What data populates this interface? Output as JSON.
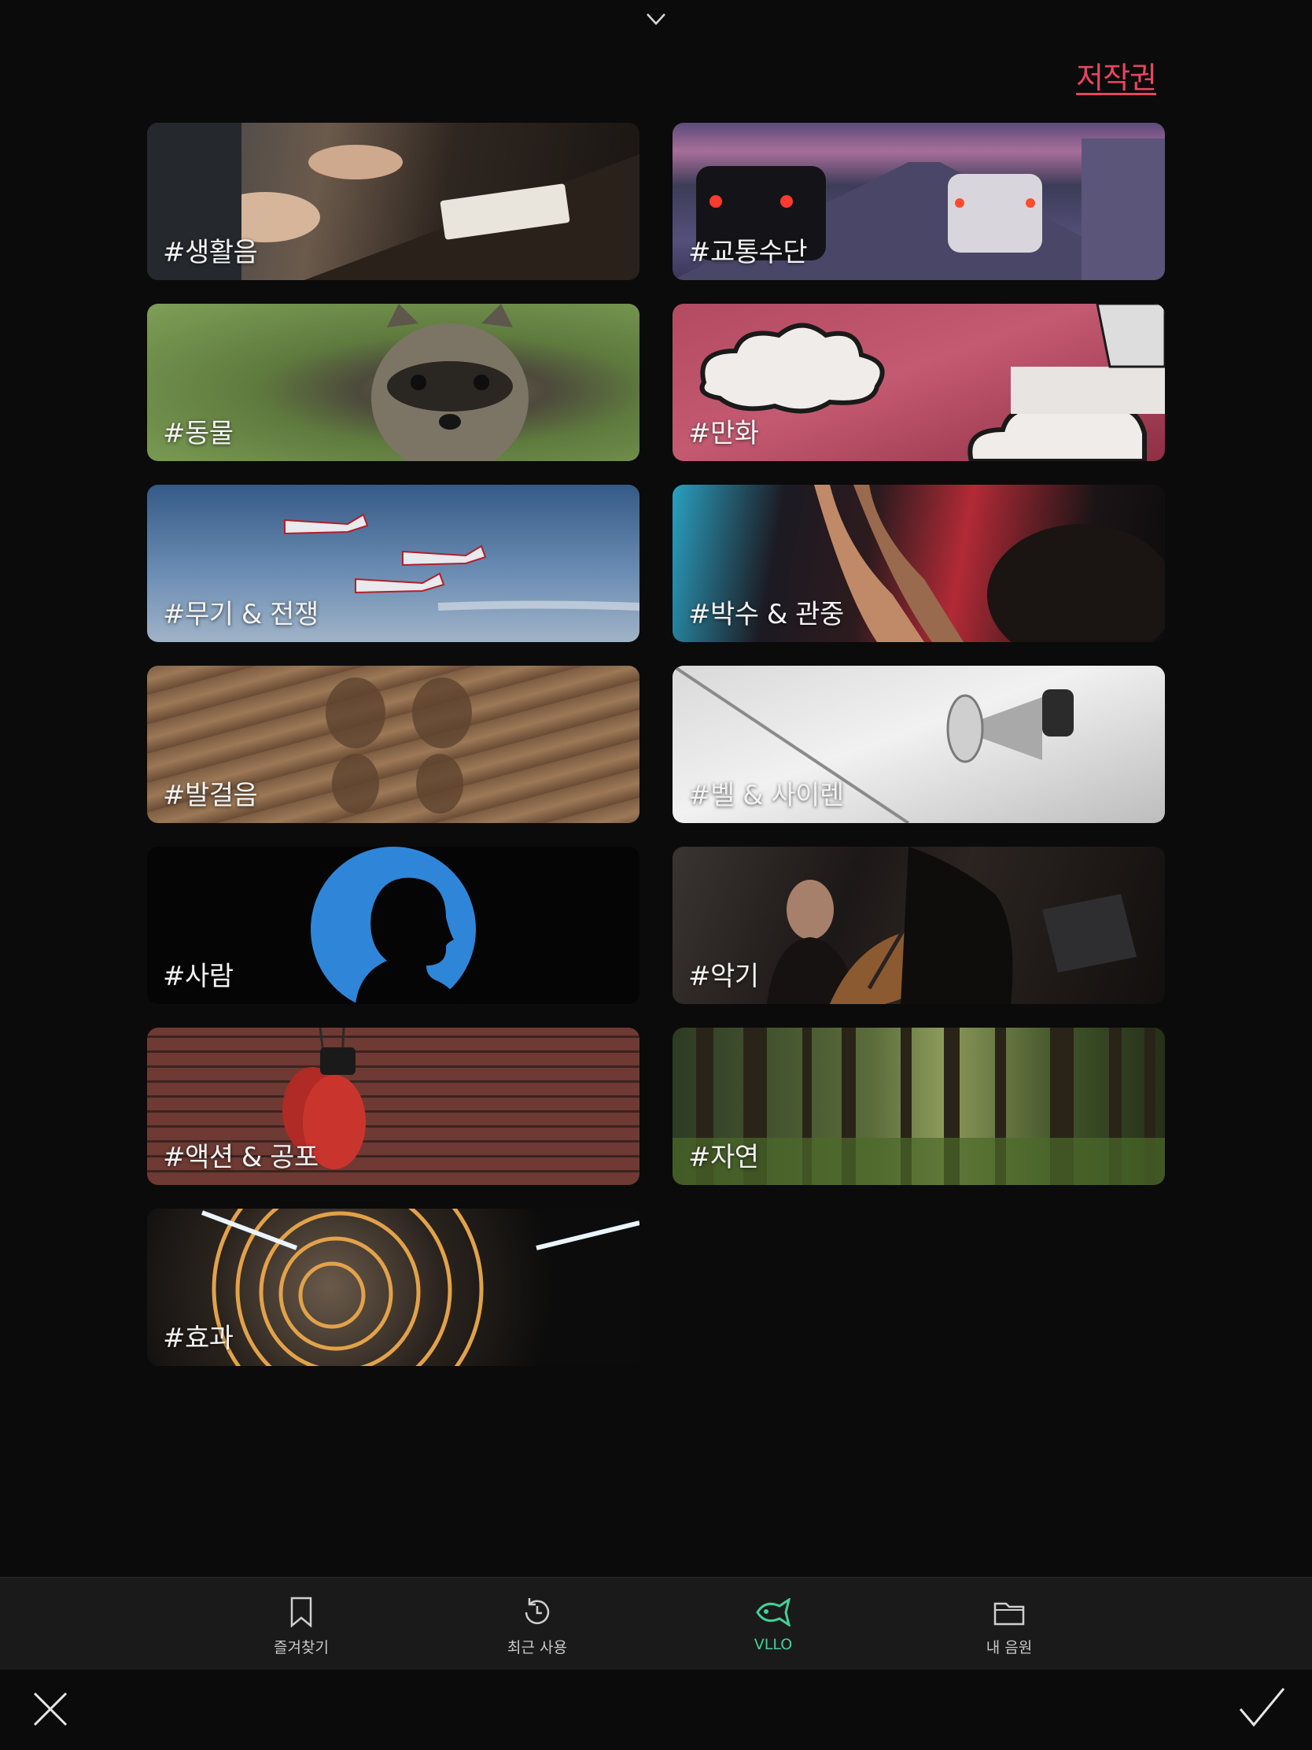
{
  "header": {
    "copyright_link": "저작권"
  },
  "categories": [
    {
      "label": "#생활음"
    },
    {
      "label": "#교통수단"
    },
    {
      "label": "#동물"
    },
    {
      "label": "#만화"
    },
    {
      "label": "#무기 & 전쟁"
    },
    {
      "label": "#박수 & 관중"
    },
    {
      "label": "#발걸음"
    },
    {
      "label": "#벨 & 사이렌"
    },
    {
      "label": "#사람"
    },
    {
      "label": "#악기"
    },
    {
      "label": "#액션 & 공포"
    },
    {
      "label": "#자연"
    },
    {
      "label": "#효과"
    }
  ],
  "bottom_nav": {
    "items": [
      {
        "label": "즐겨찾기",
        "icon": "bookmark-icon"
      },
      {
        "label": "최근 사용",
        "icon": "history-icon"
      },
      {
        "label": "VLLO",
        "icon": "vllo-fish-icon",
        "active": true
      },
      {
        "label": "내 음원",
        "icon": "folder-icon"
      }
    ],
    "active_color": "#43d09a"
  },
  "colors": {
    "accent_link": "#e8455f",
    "background": "#0b0b0b"
  }
}
